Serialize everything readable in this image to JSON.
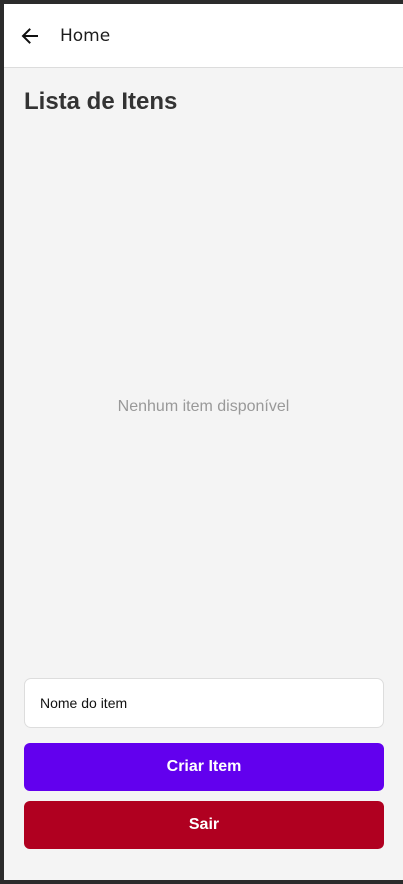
{
  "header": {
    "back_icon": "arrow-left-icon",
    "title": "Home"
  },
  "main": {
    "title": "Lista de Itens",
    "empty_message": "Nenhum item disponível"
  },
  "form": {
    "item_name_placeholder": "Nome do item",
    "item_name_value": "",
    "create_label": "Criar Item",
    "exit_label": "Sair"
  },
  "colors": {
    "create_button": "#6200ee",
    "exit_button": "#b00020",
    "background": "#f4f4f4"
  }
}
